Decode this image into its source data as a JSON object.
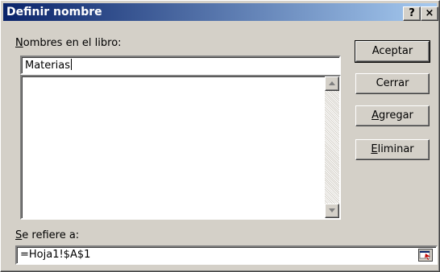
{
  "window": {
    "title": "Definir nombre",
    "help_label": "?",
    "close_label": "×"
  },
  "names": {
    "label_accel": "N",
    "label_rest": "ombres en el libro:",
    "input_value": "Materias",
    "list_items": []
  },
  "refers": {
    "label_accel": "S",
    "label_rest": "e refiere a:",
    "value": "=Hoja1!$A$1"
  },
  "buttons": {
    "accept": "Aceptar",
    "close": "Cerrar",
    "add_accel": "A",
    "add_rest": "gregar",
    "delete_accel": "E",
    "delete_rest": "liminar"
  },
  "icons": {
    "scroll_up": "triangle-up-icon",
    "scroll_down": "triangle-down-icon",
    "collapse_dialog": "collapse-dialog-icon"
  }
}
